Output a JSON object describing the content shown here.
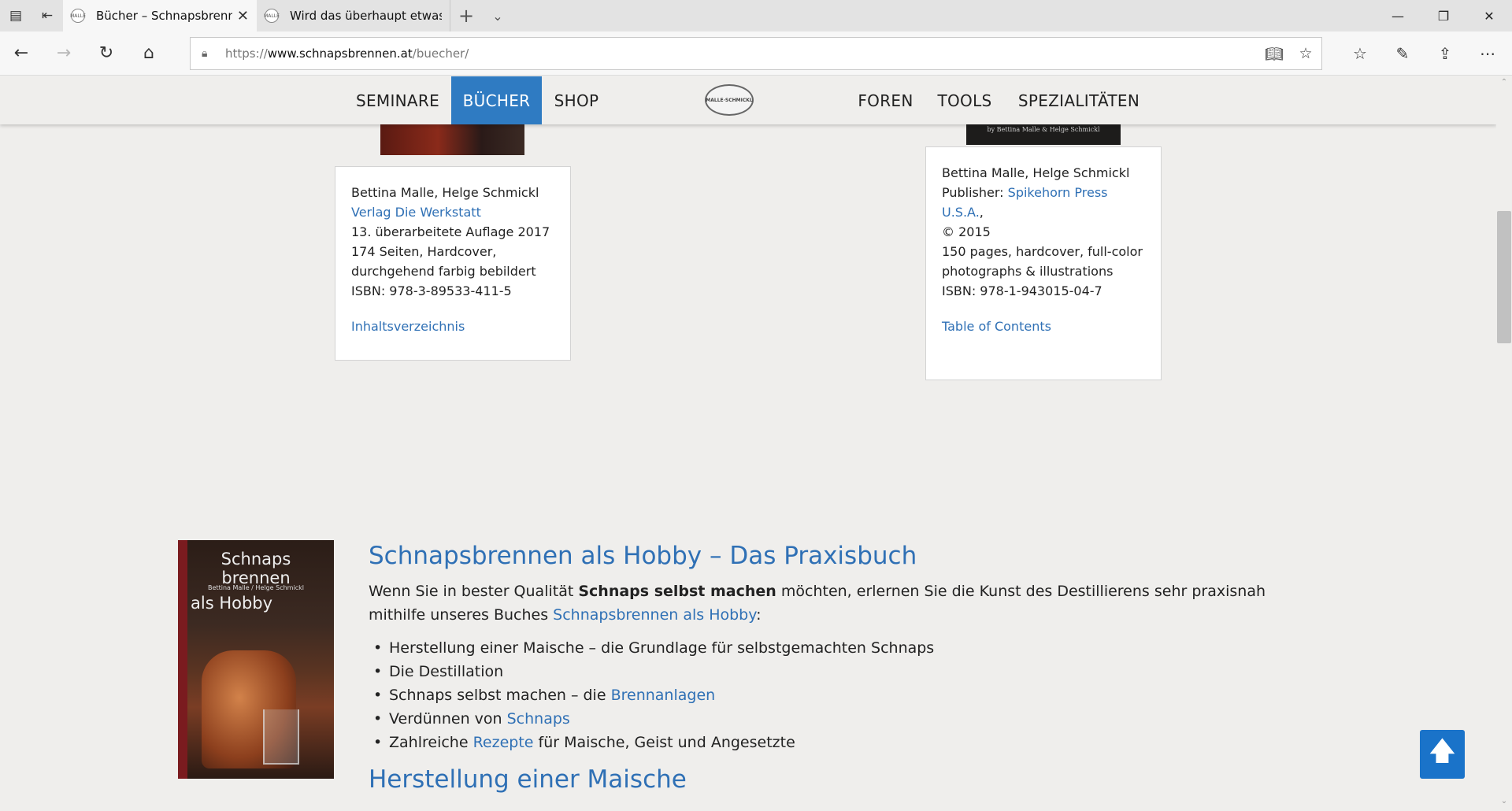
{
  "browser": {
    "tabs": [
      {
        "title": "Bücher – Schnapsbrenn",
        "favicon": "MALLE"
      },
      {
        "title": "Wird das überhaupt etwas?",
        "favicon": "MALLE"
      }
    ],
    "url": {
      "protocol": "https://",
      "host": "www.schnapsbrennen.at",
      "path": "/buecher/"
    }
  },
  "nav": {
    "items": [
      "SEMINARE",
      "BÜCHER",
      "SHOP",
      "FOREN",
      "TOOLS",
      "SPEZIALITÄTEN"
    ],
    "active": "BÜCHER",
    "logo_text": "MALLE·SCHMICKL"
  },
  "card_de": {
    "authors": "Bettina Malle, Helge Schmickl",
    "publisher": "Verlag Die Werkstatt",
    "edition": "13. überarbeitete Auflage 2017",
    "pages": "174 Seiten, Hardcover,",
    "color": "durchgehend farbig bebildert",
    "isbn": "ISBN: 978-3-89533-411-5",
    "toc": "Inhaltsverzeichnis"
  },
  "card_en": {
    "authors": "Bettina Malle, Helge Schmickl",
    "publisher_label": "Publisher: ",
    "publisher": "Spikehorn Press U.S.A.",
    "publisher_suffix": ",",
    "year": "© 2015",
    "pages": "150 pages, hardcover, full-color",
    "photos": "photographs & illustrations",
    "isbn": "ISBN: 978-1-943015-04-7",
    "toc": "Table of Contents"
  },
  "cover_en_caption": "by Bettina Malle & Helge Schmickl",
  "book_cover": {
    "title_line1": "Schnaps",
    "title_line2": "brennen",
    "authors": "Bettina Malle / Helge Schmickl",
    "title_line3": "als Hobby"
  },
  "article": {
    "heading": "Schnapsbrennen als Hobby – Das Praxisbuch",
    "intro_1": "Wenn Sie in bester Qualität ",
    "intro_bold": "Schnaps selbst machen",
    "intro_2": " möchten, erlernen Sie die Kunst des Destillierens sehr praxisnah mithilfe unseres Buches ",
    "intro_link": "Schnapsbrennen als Hobby",
    "intro_3": ":",
    "bullets": {
      "b1": "Herstellung einer Maische – die Grundlage für selbstgemachten Schnaps",
      "b2": "Die Destillation",
      "b3_text": "Schnaps selbst machen – die ",
      "b3_link": "Brennanlagen",
      "b4_text": "Verdünnen von ",
      "b4_link": "Schnaps",
      "b5_text": "Zahlreiche ",
      "b5_link": "Rezepte",
      "b5_tail": " für Maische, Geist und Angesetzte"
    },
    "subheading": "Herstellung einer Maische"
  }
}
